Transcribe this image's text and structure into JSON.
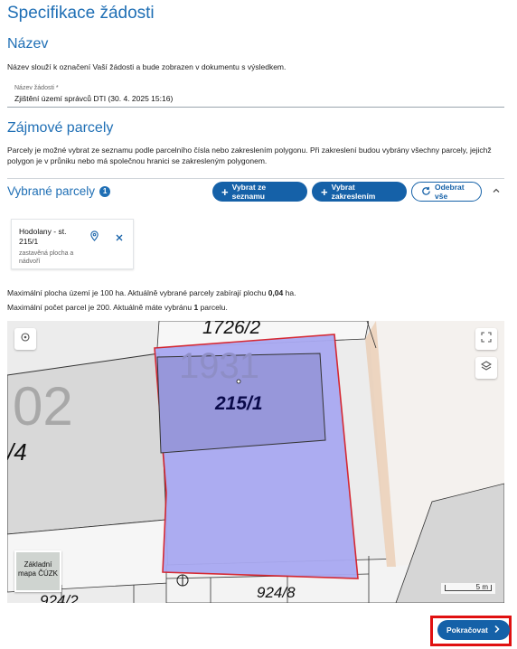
{
  "page": {
    "title": "Specifikace žádosti"
  },
  "name_section": {
    "heading": "Název",
    "description": "Název slouží k označení Vaší žádosti a bude zobrazen v dokumentu s výsledkem.",
    "field_label": "Název žádosti *",
    "field_value": "Zjištění území správců DTI (30. 4. 2025 15:16)"
  },
  "parcels_section": {
    "heading": "Zájmové parcely",
    "description_line1": "Parcely je možné vybrat ze seznamu podle parcelního čísla nebo zakreslením polygonu. Při zakreslení budou vybrány všechny parcely, jejichž",
    "description_line2": "polygon je v průniku nebo má společnou hranici se zakresleným polygonem.",
    "selected_title": "Vybrané parcely",
    "selected_count": "1",
    "btn_select_list": "Vybrat ze seznamu",
    "btn_select_draw": "Vybrat zakreslením",
    "btn_remove_all": "Odebrat vše"
  },
  "parcel_card": {
    "title": "Hodolany - st. 215/1",
    "subtitle": "zastavěná plocha a nádvoří"
  },
  "limits": {
    "area_prefix": "Maximální plocha území je 100 ha. Aktuálně vybrané parcely zabírají plochu ",
    "area_value": "0,04",
    "area_suffix": " ha.",
    "count_prefix": "Maximální počet parcel je 200. Aktuálně máte vybránu ",
    "count_value": "1",
    "count_suffix": " parcelu."
  },
  "map": {
    "labels": {
      "parcel_top": "1726/2",
      "parcel_selected": "215/1",
      "building_number": "1931",
      "left_big": "02",
      "left_small": "/4",
      "bottom_right": "924/8",
      "bottom_left": "924/2"
    },
    "basemap_label": "Základní mapa ČÚZK",
    "scale_label": "5 m",
    "colors": {
      "selection_fill": "#a9a9f2",
      "selection_border": "#d41f2a"
    }
  },
  "footer": {
    "continue_label": "Pokračovat"
  },
  "icons": [
    "plus-icon",
    "refresh-icon",
    "chevron-up-icon",
    "location-pin-icon",
    "close-icon",
    "target-icon",
    "expand-icon",
    "layers-icon",
    "chevron-right-icon"
  ],
  "colors": {
    "accent": "#1f6fb5",
    "button": "#1561a8",
    "highlight": "#e01010"
  }
}
